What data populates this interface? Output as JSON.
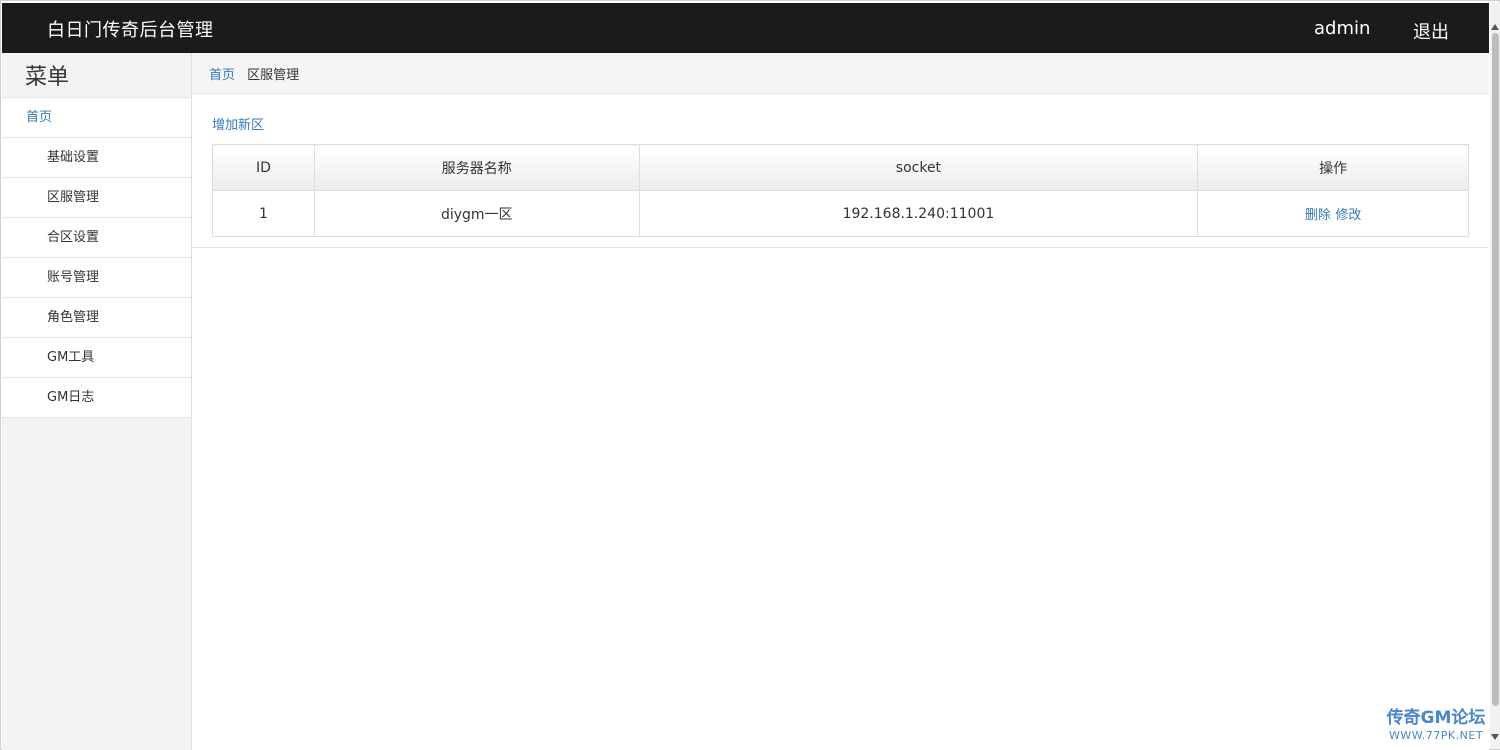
{
  "header": {
    "title": "白日门传奇后台管理",
    "user": "admin",
    "logout_label": "退出"
  },
  "sidebar": {
    "menu_title": "菜单",
    "items": [
      {
        "label": "首页",
        "level": "top"
      },
      {
        "label": "基础设置",
        "level": "sub"
      },
      {
        "label": "区服管理",
        "level": "sub"
      },
      {
        "label": "合区设置",
        "level": "sub"
      },
      {
        "label": "账号管理",
        "level": "sub"
      },
      {
        "label": "角色管理",
        "level": "sub"
      },
      {
        "label": "GM工具",
        "level": "sub"
      },
      {
        "label": "GM日志",
        "level": "sub"
      }
    ]
  },
  "breadcrumb": {
    "home": "首页",
    "current": "区服管理"
  },
  "main": {
    "add_label": "增加新区",
    "table": {
      "headers": [
        "ID",
        "服务器名称",
        "socket",
        "操作"
      ],
      "rows": [
        {
          "id": "1",
          "name": "diygm一区",
          "socket": "192.168.1.240:11001",
          "delete_label": "删除",
          "edit_label": "修改"
        }
      ]
    }
  },
  "watermark": {
    "line1": "传奇GM论坛",
    "line2": "WWW.77PK.NET"
  },
  "colors": {
    "topbar": "#1b1b1b",
    "link": "#337ab7",
    "sidebar_bg": "#f2f2f2"
  }
}
